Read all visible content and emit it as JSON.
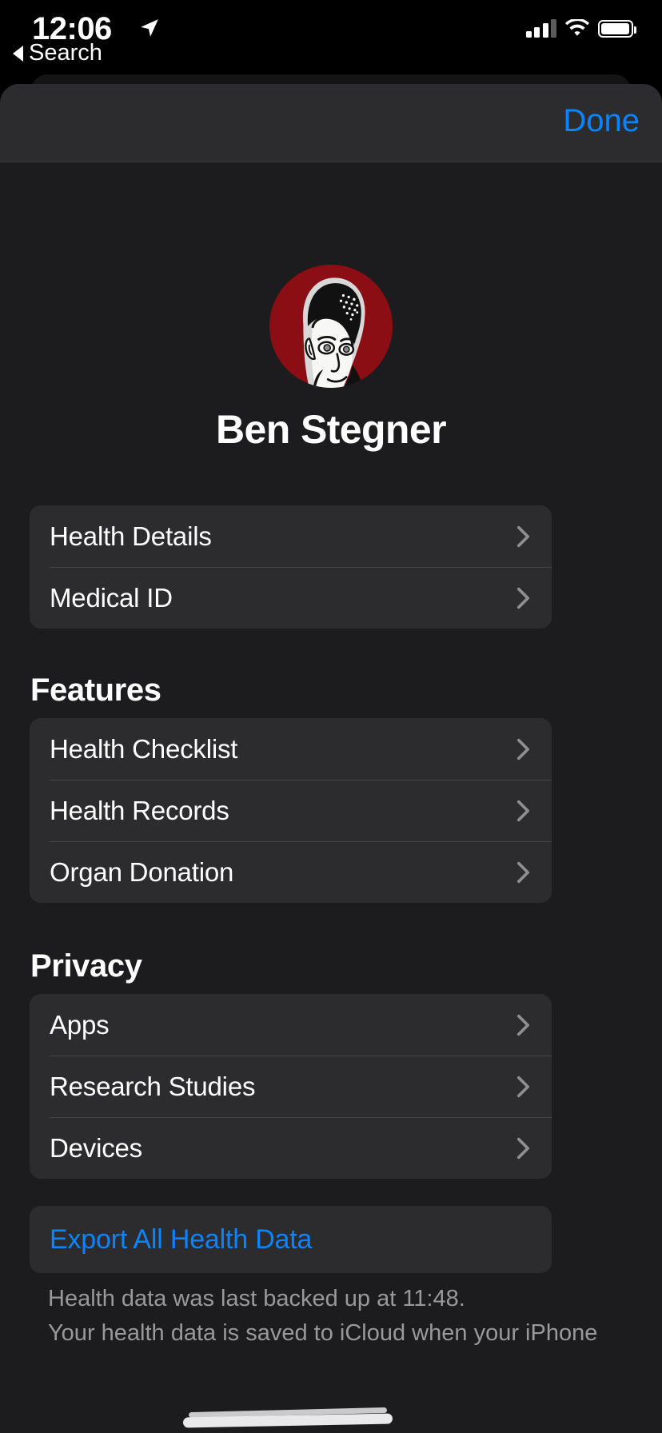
{
  "status_bar": {
    "time": "12:06",
    "location_icon": "location-arrow-icon",
    "cellular_icon": "cellular-signal-icon",
    "wifi_icon": "wifi-icon",
    "battery_icon": "battery-icon"
  },
  "back_link": {
    "label": "Search",
    "icon": "back-triangle-icon"
  },
  "sheet": {
    "done_label": "Done"
  },
  "profile": {
    "name": "Ben Stegner",
    "avatar_alt": "user-avatar",
    "avatar_bg_color": "#8B0E14"
  },
  "groups": [
    {
      "header": "",
      "items": [
        {
          "label": "Health Details",
          "accessory": "chevron-right-icon"
        },
        {
          "label": "Medical ID",
          "accessory": "chevron-right-icon"
        }
      ]
    },
    {
      "header": "Features",
      "items": [
        {
          "label": "Health Checklist",
          "accessory": "chevron-right-icon"
        },
        {
          "label": "Health Records",
          "accessory": "chevron-right-icon"
        },
        {
          "label": "Organ Donation",
          "accessory": "chevron-right-icon"
        }
      ]
    },
    {
      "header": "Privacy",
      "items": [
        {
          "label": "Apps",
          "accessory": "chevron-right-icon"
        },
        {
          "label": "Research Studies",
          "accessory": "chevron-right-icon"
        },
        {
          "label": "Devices",
          "accessory": "chevron-right-icon"
        }
      ]
    }
  ],
  "export": {
    "label": "Export All Health Data",
    "accent_color": "#0A84FF"
  },
  "footer": {
    "line1": "Health data was last backed up at 11:48.",
    "line2": "Your health data is saved to iCloud when your iPhone"
  }
}
